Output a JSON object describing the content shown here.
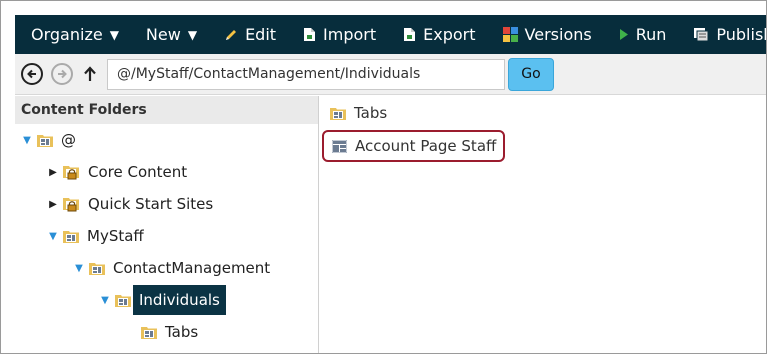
{
  "toolbar": {
    "organize": "Organize",
    "new": "New",
    "edit": "Edit",
    "import": "Import",
    "export": "Export",
    "versions": "Versions",
    "run": "Run",
    "publish": "Publish"
  },
  "address": {
    "path": "@/MyStaff/ContactManagement/Individuals",
    "go_label": "Go"
  },
  "left_panel": {
    "header": "Content Folders",
    "tree": [
      {
        "label": "@",
        "state": "open"
      },
      {
        "label": "Core Content",
        "state": "collapsed"
      },
      {
        "label": "Quick Start Sites",
        "state": "collapsed"
      },
      {
        "label": "MyStaff",
        "state": "open"
      },
      {
        "label": "ContactManagement",
        "state": "open"
      },
      {
        "label": "Individuals",
        "state": "open",
        "selected": true
      },
      {
        "label": "Tabs",
        "state": "leaf"
      }
    ]
  },
  "right_panel": {
    "items": [
      {
        "label": "Tabs",
        "icon": "folder-icon"
      },
      {
        "label": "Account Page Staff",
        "icon": "page-layout-icon",
        "highlighted": true
      }
    ]
  },
  "colors": {
    "toolbar_bg": "#072d3c",
    "go_button": "#5bc0f0",
    "selection_bg": "#0b3344",
    "highlight_border": "#9b1c2e",
    "toggle_open": "#2a8fd6"
  }
}
